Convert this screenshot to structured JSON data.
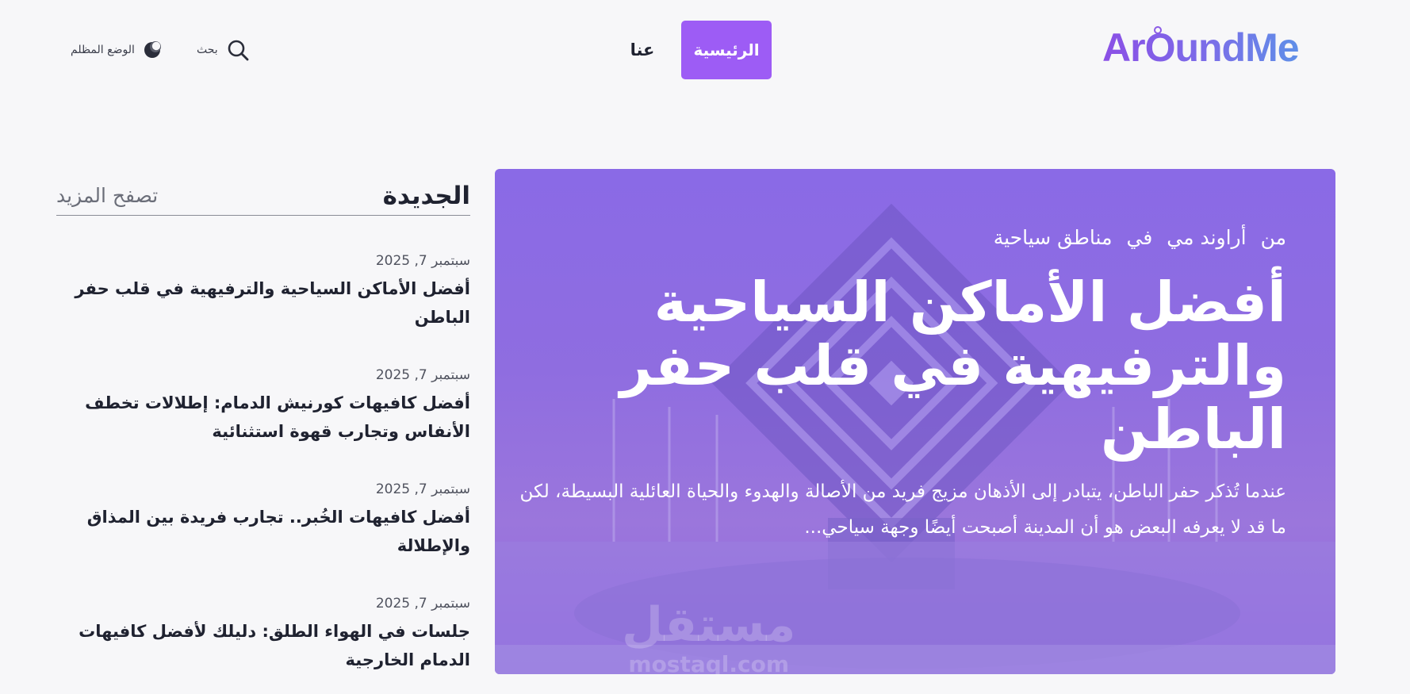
{
  "header": {
    "logo": "ArOundMe",
    "nav": {
      "home": "الرئيسية",
      "about": "عنا"
    },
    "search_label": "بحث",
    "dark_mode_label": "الوضع المظلم"
  },
  "colors": {
    "accent": "#9d5cf5",
    "hero_overlay": "#8a6ae6",
    "background": "#f7f7f9"
  },
  "sidebar": {
    "title": "الجديدة",
    "more": "تصفح المزيد",
    "posts": [
      {
        "date": "سبتمبر 7, 2025",
        "title": "أفضل الأماكن السياحية والترفيهية في قلب حفر الباطن"
      },
      {
        "date": "سبتمبر 7, 2025",
        "title": "أفضل كافيهات كورنيش الدمام: إطلالات تخطف الأنفاس وتجارب قهوة استثنائية"
      },
      {
        "date": "سبتمبر 7, 2025",
        "title": "أفضل كافيهات الخُبر.. تجارب فريدة بين المذاق والإطلالة"
      },
      {
        "date": "سبتمبر 7, 2025",
        "title": "جلسات في الهواء الطلق: دليلك لأفضل كافيهات الدمام الخارجية"
      }
    ]
  },
  "hero": {
    "from": "من",
    "author": "أراوند مي",
    "in": "في",
    "category": "مناطق سياحية",
    "title": "أفضل الأماكن السياحية والترفيهية في قلب حفر الباطن",
    "excerpt": "عندما تُذكر حفر الباطن، يتبادر إلى الأذهان مزيج فريد من الأصالة والهدوء والحياة العائلية البسيطة، لكن ما قد لا يعرفه البعض هو أن المدينة أصبحت أيضًا وجهة سياحي...",
    "watermark_ar": "مستقل",
    "watermark_en": "mostaql.com"
  }
}
